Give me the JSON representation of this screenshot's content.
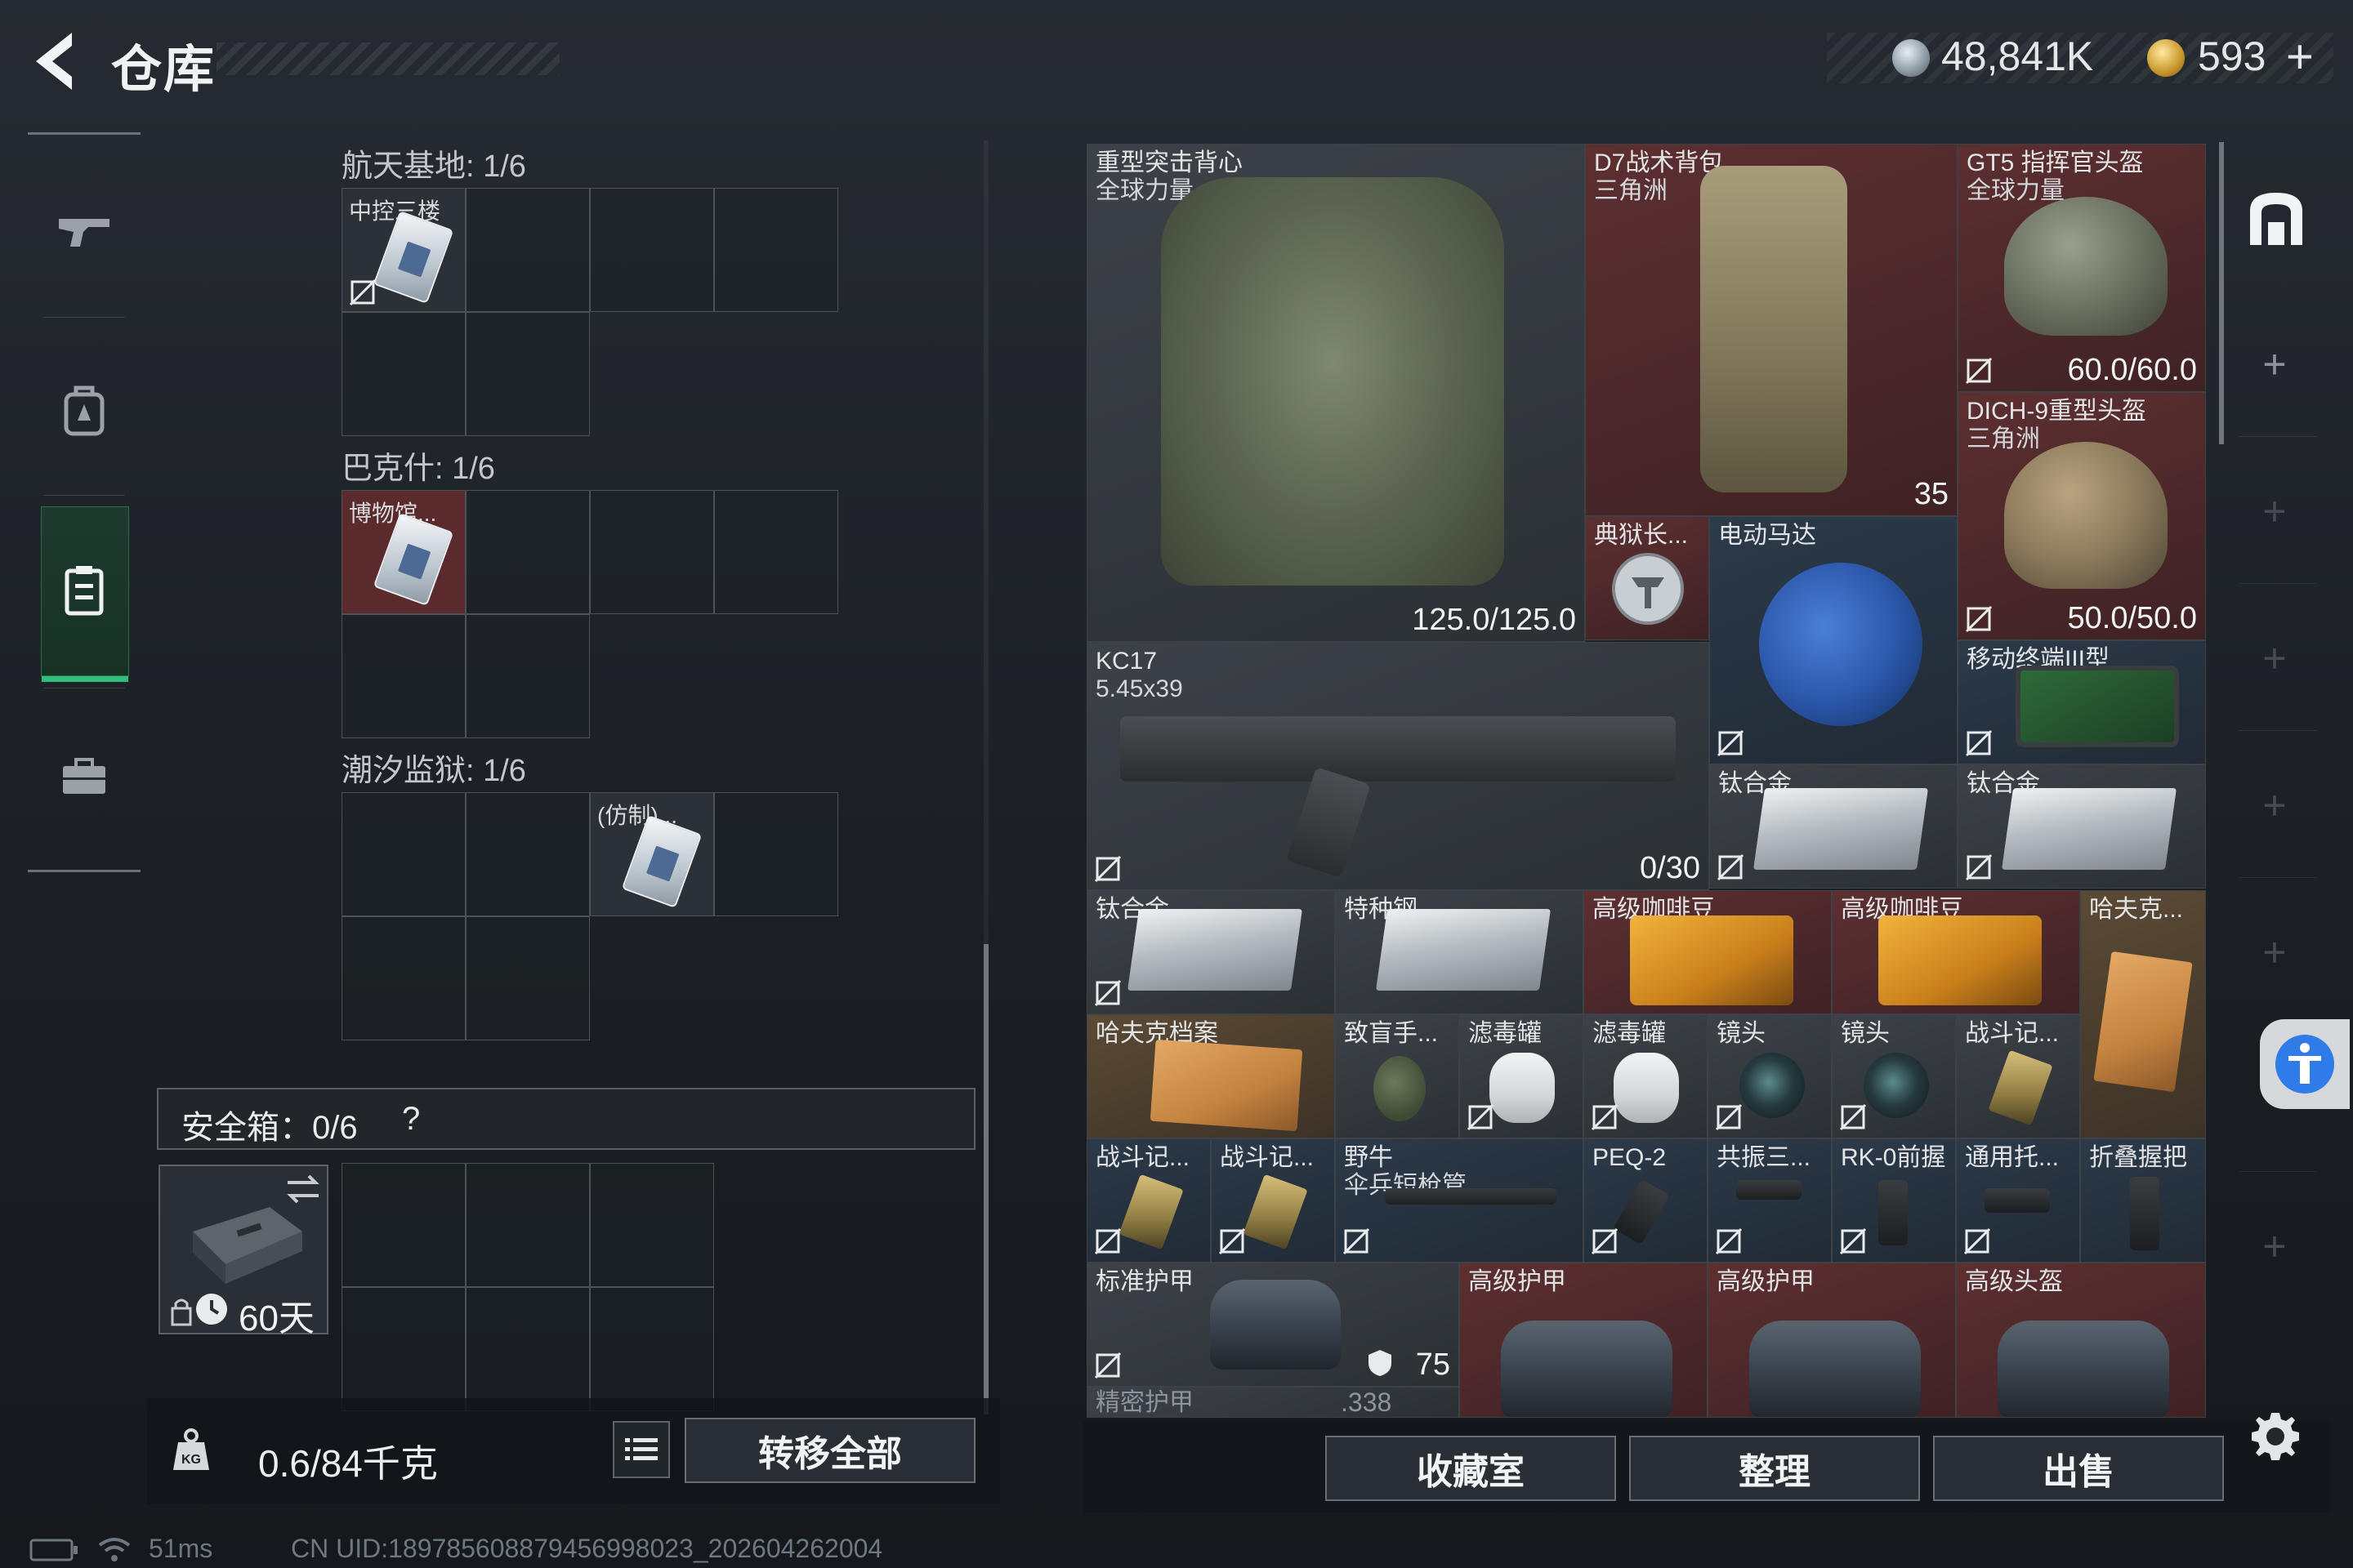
{
  "header": {
    "title": "仓库",
    "currency_silver": "48,841K",
    "currency_gold": "593",
    "gold_plus": "+"
  },
  "left_nav": {
    "items": [
      {
        "icon": "gun-icon"
      },
      {
        "icon": "backpack-icon"
      },
      {
        "icon": "inventory-icon",
        "active": true
      },
      {
        "icon": "briefcase-icon"
      }
    ],
    "active_color": "#2ec07a"
  },
  "stash": {
    "sections": [
      {
        "label": "航天基地: 1/6",
        "item": {
          "name": "中控三楼",
          "col": 0,
          "bg": "grey"
        }
      },
      {
        "label": "巴克什: 1/6",
        "item": {
          "name": "博物馆...",
          "col": 0,
          "bg": "red"
        }
      },
      {
        "label": "潮汐监狱: 1/6",
        "item": {
          "name": "(仿制)...",
          "col": 2,
          "bg": "grey"
        }
      }
    ],
    "safe_box": {
      "label": "安全箱：0/6",
      "help": "?",
      "days": "60天"
    },
    "weight": "0.6/84千克",
    "transfer_all": "转移全部"
  },
  "backpack": {
    "items": [
      {
        "name": "重型突击背心",
        "sub": "全球力量",
        "value": "125.0/125.0",
        "bg": "grey",
        "art": "vest"
      },
      {
        "name": "D7战术背包",
        "sub": "三角洲",
        "value": "35",
        "bg": "red",
        "art": "bag"
      },
      {
        "name": "GT5 指挥官头盔",
        "sub": "全球力量",
        "value": "60.0/60.0",
        "bg": "red",
        "art": "helmet"
      },
      {
        "name": "DICH-9重型头盔",
        "sub": "三角洲",
        "value": "50.0/50.0",
        "bg": "red",
        "art": "helmet-tan"
      },
      {
        "name": "典狱长...",
        "sub": "",
        "value": "",
        "bg": "red",
        "art": "badge"
      },
      {
        "name": "电动马达",
        "sub": "",
        "value": "",
        "bg": "blue",
        "art": "motor"
      },
      {
        "name": "KC17",
        "sub": "5.45x39",
        "value": "0/30",
        "bg": "grey",
        "art": "rifle"
      },
      {
        "name": "移动终端III型",
        "sub": "",
        "value": "",
        "bg": "blue",
        "art": "screen"
      },
      {
        "name": "钛合金",
        "sub": "",
        "value": "",
        "bg": "grey",
        "art": "ingot"
      },
      {
        "name": "钛合金",
        "sub": "",
        "value": "",
        "bg": "grey",
        "art": "ingot"
      },
      {
        "name": "钛合金",
        "sub": "",
        "value": "",
        "bg": "grey",
        "art": "ingot"
      },
      {
        "name": "特种钢",
        "sub": "",
        "value": "",
        "bg": "grey",
        "art": "ingot"
      },
      {
        "name": "高级咖啡豆",
        "sub": "",
        "value": "",
        "bg": "red",
        "art": "coffee"
      },
      {
        "name": "高级咖啡豆",
        "sub": "",
        "value": "",
        "bg": "red",
        "art": "coffee"
      },
      {
        "name": "哈夫克...",
        "sub": "",
        "value": "",
        "bg": "gold",
        "art": "folder"
      },
      {
        "name": "哈夫克档案",
        "sub": "",
        "value": "",
        "bg": "gold",
        "art": "folder"
      },
      {
        "name": "致盲手...",
        "sub": "",
        "value": "",
        "bg": "grey",
        "art": "grenade"
      },
      {
        "name": "滤毒罐",
        "sub": "",
        "value": "",
        "bg": "grey",
        "art": "canister"
      },
      {
        "name": "滤毒罐",
        "sub": "",
        "value": "",
        "bg": "grey",
        "art": "canister"
      },
      {
        "name": "镜头",
        "sub": "",
        "value": "",
        "bg": "grey",
        "art": "lens"
      },
      {
        "name": "镜头",
        "sub": "",
        "value": "",
        "bg": "grey",
        "art": "lens"
      },
      {
        "name": "战斗记...",
        "sub": "",
        "value": "",
        "bg": "grey",
        "art": "battlecard"
      },
      {
        "name": "战斗记...",
        "sub": "",
        "value": "",
        "bg": "blue",
        "art": "battlecard"
      },
      {
        "name": "战斗记...",
        "sub": "",
        "value": "",
        "bg": "blue",
        "art": "battlecard"
      },
      {
        "name": "野牛",
        "sub": "伞兵短枪管",
        "value": "",
        "bg": "blue",
        "art": "barrel"
      },
      {
        "name": "PEQ-2",
        "sub": "",
        "value": "",
        "bg": "blue",
        "art": "grip"
      },
      {
        "name": "共振三...",
        "sub": "",
        "value": "",
        "bg": "blue",
        "art": "grip"
      },
      {
        "name": "RK-0前握",
        "sub": "",
        "value": "",
        "bg": "blue",
        "art": "grip"
      },
      {
        "name": "通用托...",
        "sub": "",
        "value": "",
        "bg": "blue",
        "art": "grip"
      },
      {
        "name": "折叠握把",
        "sub": "",
        "value": "",
        "bg": "blue",
        "art": "grip"
      },
      {
        "name": "标准护甲",
        "sub": "",
        "value": "75",
        "bg": "grey",
        "art": "armor"
      },
      {
        "name": "高级护甲",
        "sub": "",
        "value": "",
        "bg": "red",
        "art": "armor"
      },
      {
        "name": "高级护甲",
        "sub": "",
        "value": "",
        "bg": "red",
        "art": "armor"
      },
      {
        "name": "高级头盔",
        "sub": "",
        "value": "",
        "bg": "red",
        "art": "armor"
      },
      {
        "name": "精密护甲",
        "sub": "",
        "value": ".338",
        "bg": "grey",
        "art": ""
      }
    ]
  },
  "actions": {
    "collection": "收藏室",
    "organize": "整理",
    "sell": "出售"
  },
  "status_bar": {
    "ping": "51ms",
    "uid": "CN UID:1897856088794569980​23_202604262004"
  },
  "colors": {
    "accent_green": "#2ec07a",
    "rarity_red": "#5d2f31",
    "rarity_gold": "#5b4a35",
    "rarity_blue": "#2c3a4a",
    "rarity_grey": "#3d4248"
  }
}
